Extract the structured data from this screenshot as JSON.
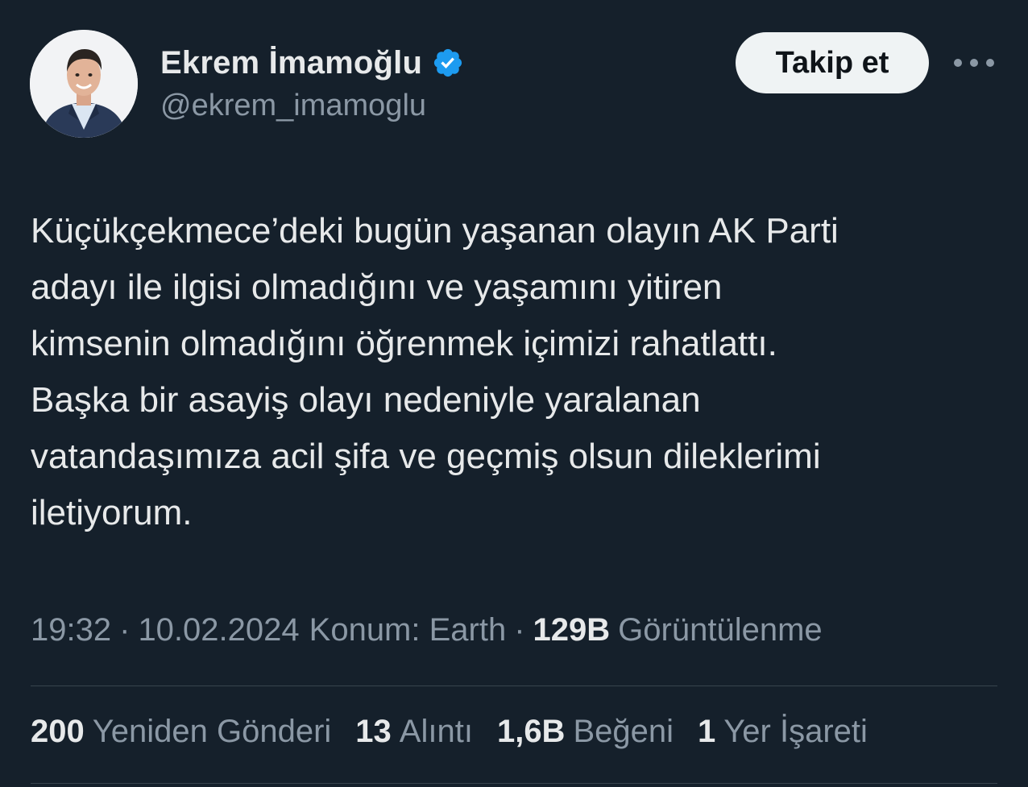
{
  "author": {
    "display_name": "Ekrem İmamoğlu",
    "handle": "@ekrem_imamoglu",
    "verified": true,
    "verified_color": "#1d9bf0"
  },
  "header": {
    "follow_label": "Takip et",
    "more_icon": "more-horizontal-icon"
  },
  "tweet": {
    "lines": [
      "Küçükçekmece’deki bugün yaşanan olayın AK Parti",
      "adayı ile ilgisi olmadığını ve yaşamını yitiren",
      "kimsenin olmadığını öğrenmek içimizi rahatlattı.",
      "Başka bir asayiş olayı nedeniyle yaralanan",
      "vatandaşımıza acil şifa ve geçmiş olsun dileklerimi",
      "iletiyorum."
    ]
  },
  "meta": {
    "time": "19:32",
    "date": "10.02.2024",
    "location": "Konum: Earth",
    "separator": "·",
    "views_count": "129B",
    "views_label": "Görüntülenme"
  },
  "stats": [
    {
      "count": "200",
      "label": "Yeniden Gönderi"
    },
    {
      "count": "13",
      "label": "Alıntı"
    },
    {
      "count": "1,6B",
      "label": "Beğeni"
    },
    {
      "count": "1",
      "label": "Yer İşareti"
    }
  ],
  "colors": {
    "background": "#15202b",
    "primary_text": "#e7e9ea",
    "secondary_text": "#8b98a5",
    "divider": "#38444d",
    "follow_button_bg": "#eff3f4"
  }
}
